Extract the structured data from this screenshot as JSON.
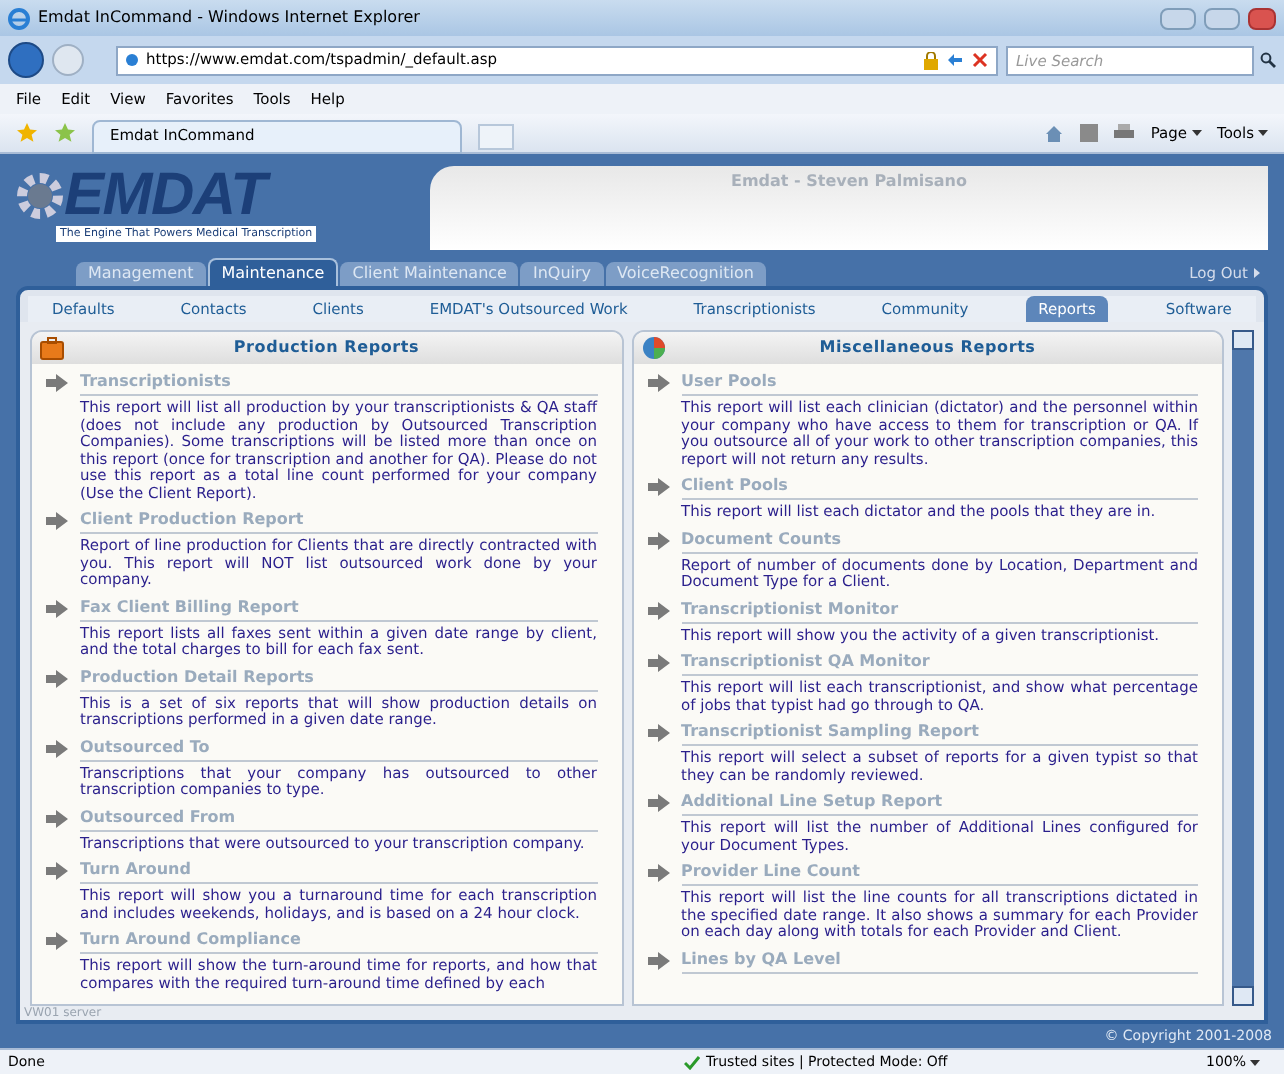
{
  "browser": {
    "title": "Emdat InCommand - Windows Internet Explorer",
    "address": "https://www.emdat.com/tspadmin/_default.asp",
    "search_placeholder": "Live Search",
    "menu": [
      "File",
      "Edit",
      "View",
      "Favorites",
      "Tools",
      "Help"
    ],
    "tab_title": "Emdat InCommand",
    "toolbar": [
      "Page",
      "Tools"
    ]
  },
  "app": {
    "logo": "EMDAT",
    "tagline": "The Engine That Powers Medical Transcription",
    "user_name": "Emdat - Steven Palmisano",
    "tabs": [
      {
        "label": "Management",
        "selected": false
      },
      {
        "label": "Maintenance",
        "selected": true
      },
      {
        "label": "Client Maintenance",
        "selected": false
      },
      {
        "label": "InQuiry",
        "selected": false
      },
      {
        "label": "VoiceRecognition",
        "selected": false
      }
    ],
    "log_out": "Log Out",
    "subtabs": [
      {
        "label": "Defaults",
        "selected": false
      },
      {
        "label": "Contacts",
        "selected": false
      },
      {
        "label": "Clients",
        "selected": false
      },
      {
        "label": "EMDAT's Outsourced Work",
        "selected": false
      },
      {
        "label": "Transcriptionists",
        "selected": false
      },
      {
        "label": "Community",
        "selected": false
      },
      {
        "label": "Reports",
        "selected": true
      },
      {
        "label": "Software",
        "selected": false
      }
    ],
    "panels": [
      {
        "title": "Production Reports",
        "kind": "briefcase",
        "reports": [
          {
            "title": "Transcriptionists",
            "description": "This report will list all production by your transcriptionists & QA staff (does not include any production by Outsourced Transcription Companies). Some transcriptions will be listed more than once on this report (once for transcription and another for QA). Please do not use this report as a total line count performed for your company (Use the Client Report)."
          },
          {
            "title": "Client Production Report",
            "description": "Report of line production for Clients that are directly contracted with you. This report will NOT list outsourced work done by your company."
          },
          {
            "title": "Fax Client Billing Report",
            "description": "This report lists all faxes sent within a given date range by client, and the total charges to bill for each fax sent."
          },
          {
            "title": "Production Detail Reports",
            "description": "This is a set of six reports that will show production details on transcriptions performed in a given date range."
          },
          {
            "title": "Outsourced To",
            "description": "Transcriptions that your company has outsourced to other transcription companies to type."
          },
          {
            "title": "Outsourced From",
            "description": "Transcriptions that were outsourced to your transcription company."
          },
          {
            "title": "Turn Around",
            "description": "This report will show you a turnaround time for each transcription and includes weekends, holidays, and is based on a 24 hour clock."
          },
          {
            "title": "Turn Around Compliance",
            "description": "This report will show the turn-around time for reports, and how that compares with the required turn-around time defined by each"
          }
        ]
      },
      {
        "title": "Miscellaneous Reports",
        "kind": "chart",
        "reports": [
          {
            "title": "User Pools",
            "description": "This report will list each clinician (dictator) and the personnel within your company who have access to them for transcription or QA. If you outsource all of your work to other transcription companies, this report will not return any results."
          },
          {
            "title": "Client Pools",
            "description": "This report will list each dictator and the pools that they are in."
          },
          {
            "title": "Document Counts",
            "description": "Report of number of documents done by Location, Department and Document Type for a Client."
          },
          {
            "title": "Transcriptionist Monitor",
            "description": "This report will show you the activity of a given transcriptionist."
          },
          {
            "title": "Transcriptionist QA Monitor",
            "description": "This report will list each transcriptionist, and show what percentage of jobs that typist had go through to QA."
          },
          {
            "title": "Transcriptionist Sampling Report",
            "description": "This report will select a subset of reports for a given typist so that they can be randomly reviewed."
          },
          {
            "title": "Additional Line Setup Report",
            "description": "This report will list the number of Additional Lines configured for your Document Types."
          },
          {
            "title": "Provider Line Count",
            "description": "This report will list the line counts for all transcriptions dictated in the specified date range. It also shows a summary for each Provider on each day along with totals for each Provider and Client."
          },
          {
            "title": "Lines by QA Level"
          }
        ]
      }
    ],
    "server_label": "VW01 server",
    "copyright": "© Copyright 2001-2008"
  },
  "status_bar": {
    "text": "Done",
    "zone": "Trusted sites | Protected Mode: Off",
    "zoom": "100%"
  }
}
